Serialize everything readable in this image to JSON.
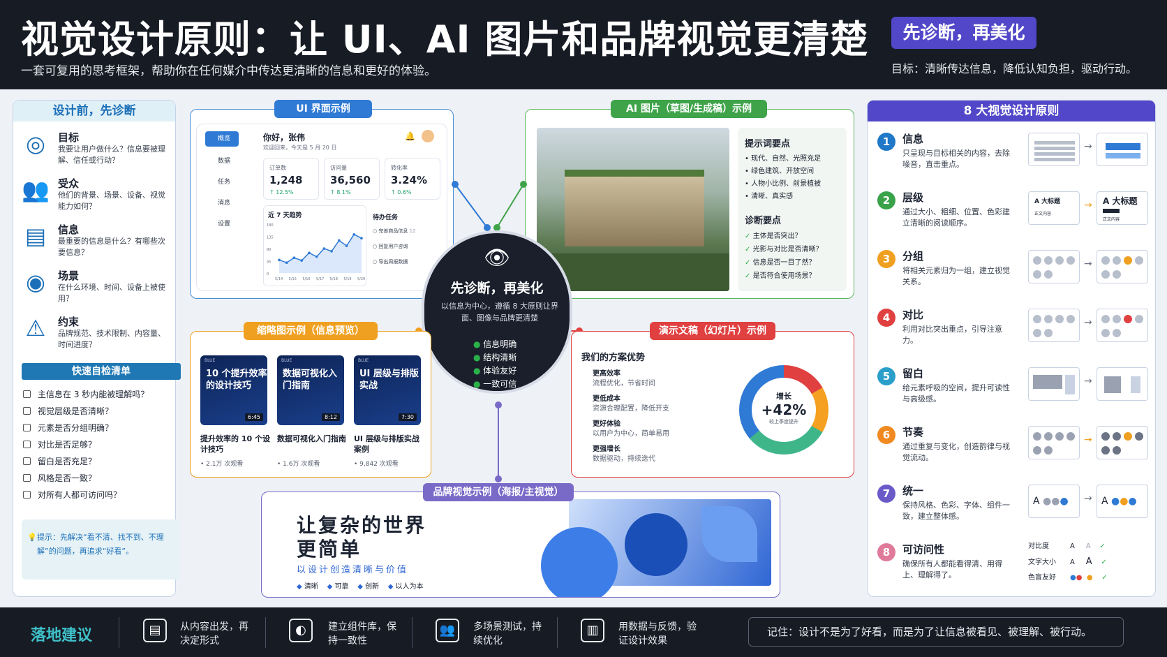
{
  "header": {
    "title": "视觉设计原则：让 UI、AI 图片和品牌视觉更清楚",
    "subtitle": "一套可复用的思考框架，帮助你在任何媒介中传达更清晰的信息和更好的体验。",
    "badge": "先诊断，再美化",
    "goal": "目标：清晰传达信息，降低认知负担，驱动行动。"
  },
  "left": {
    "title": "设计前，先诊断",
    "items": [
      {
        "icon": "target-icon",
        "title": "目标",
        "desc": "我要让用户做什么？信息要被理解、信任或行动？"
      },
      {
        "icon": "people-icon",
        "title": "受众",
        "desc": "他们的背景、场景、设备、视觉能力如何？"
      },
      {
        "icon": "document-icon",
        "title": "信息",
        "desc": "最重要的信息是什么？有哪些次要信息？"
      },
      {
        "icon": "eye-icon",
        "title": "场景",
        "desc": "在什么环境、时间、设备上被使用？"
      },
      {
        "icon": "warning-icon",
        "title": "约束",
        "desc": "品牌规范、技术限制、内容量、时间进度？"
      }
    ],
    "checklist_title": "快速自检清单",
    "checklist": [
      "主信息在 3 秒内能被理解吗？",
      "视觉层级是否清晰？",
      "元素是否分组明确？",
      "对比是否足够？",
      "留白是否充足？",
      "风格是否一致？",
      "对所有人都可访问吗？"
    ],
    "tip": "提示：先解决“看不清、找不到、不理解”的问题，再追求“好看”。"
  },
  "ui": {
    "title": "UI 界面示例",
    "nav": [
      "概览",
      "数据",
      "任务",
      "消息",
      "设置"
    ],
    "greeting": "你好，张伟",
    "welcome": "欢迎回来，今天是 5 月 20 日",
    "stats": [
      {
        "label": "订单数",
        "value": "1,248",
        "change": "↑ 12.5%"
      },
      {
        "label": "访问量",
        "value": "36,560",
        "change": "↑ 8.1%"
      },
      {
        "label": "转化率",
        "value": "3.24%",
        "change": "↑ 0.6%"
      }
    ],
    "trend_title": "近 7 天趋势",
    "trend_y": [
      "180",
      "135",
      "90",
      "45",
      "0"
    ],
    "trend_x": [
      "5/14",
      "5/15",
      "5/16",
      "5/17",
      "5/18",
      "5/19",
      "5/20"
    ],
    "trend_values": [
      48,
      38,
      56,
      46,
      74,
      60,
      90,
      80,
      120,
      100,
      142,
      128
    ],
    "todo_title": "待办任务",
    "todos": [
      "完善商品信息",
      "回复用户咨询",
      "导出周报数据"
    ],
    "todo_count": "12"
  },
  "ai": {
    "title": "AI 图片（草图/生成稿）示例",
    "prompt_title": "提示词要点",
    "prompts": [
      "现代、自然、光照充足",
      "绿色建筑、开放空间",
      "人物小比例、前景植被",
      "清晰、真实感"
    ],
    "diag_title": "诊断要点",
    "diags": [
      "主体是否突出？",
      "光影与对比是否清晰？",
      "信息是否一目了然？",
      "是否符合使用场景？"
    ]
  },
  "center": {
    "title": "先诊断，再美化",
    "desc": "以信息为中心，遵循 8 大原则让界面、图像与品牌更清楚",
    "checks": [
      "信息明确",
      "结构清晰",
      "体验友好",
      "一致可信"
    ]
  },
  "thumbs": {
    "title": "缩略图示例（信息预览）",
    "items": [
      {
        "text": "10 个提升效率的设计技巧",
        "tag": "6:45",
        "caption": "提升效率的 10 个设计技巧",
        "views": "• 2.1万 次观看",
        "badge": "BLUE"
      },
      {
        "text": "数据可视化入门指南",
        "tag": "8:12",
        "caption": "数据可视化入门指南",
        "views": "• 1.6万 次观看",
        "badge": "BLUE"
      },
      {
        "text": "UI 层级与排版实战",
        "tag": "7:30",
        "caption": "UI 层级与排版实战案例",
        "views": "• 9,842 次观看",
        "badge": "BLUE"
      }
    ]
  },
  "slides": {
    "title": "演示文稿（幻灯片）示例",
    "heading": "我们的方案优势",
    "items": [
      {
        "title": "更高效率",
        "desc": "流程优化，节省时间"
      },
      {
        "title": "更低成本",
        "desc": "资源合理配置，降低开支"
      },
      {
        "title": "更好体验",
        "desc": "以用户为中心，简单易用"
      },
      {
        "title": "更强增长",
        "desc": "数据驱动，持续迭代"
      }
    ],
    "donut_label": "增长",
    "donut_value": "+42%",
    "donut_sub": "较上季度提升"
  },
  "brand": {
    "title": "品牌视觉示例（海报/主视觉）",
    "headline1": "让复杂的世界",
    "headline2": "更简单",
    "slogan": "以设计创造清晰与价值",
    "tags": [
      "清晰",
      "可靠",
      "创新",
      "以人为本"
    ]
  },
  "principles": {
    "title": "8 大视觉设计原则",
    "items": [
      {
        "num": "1",
        "title": "信息",
        "desc": "只呈现与目标相关的内容，去除噪音，直击重点。",
        "color": "#1f78c8"
      },
      {
        "num": "2",
        "title": "层级",
        "desc": "通过大小、粗细、位置、色彩建立清晰的阅读顺序。",
        "color": "#3aa34a",
        "a": "A 大标题",
        "b": "正文内容"
      },
      {
        "num": "3",
        "title": "分组",
        "desc": "将相关元素归为一组，建立视觉关系。",
        "color": "#f0a020"
      },
      {
        "num": "4",
        "title": "对比",
        "desc": "利用对比突出重点，引导注意力。",
        "color": "#e04040"
      },
      {
        "num": "5",
        "title": "留白",
        "desc": "给元素呼吸的空间，提升可读性与高级感。",
        "color": "#2a9fc9"
      },
      {
        "num": "6",
        "title": "节奏",
        "desc": "通过重复与变化，创造韵律与视觉流动。",
        "color": "#f08a20"
      },
      {
        "num": "7",
        "title": "统一",
        "desc": "保持风格、色彩、字体、组件一致，建立整体感。",
        "color": "#6a5ac8"
      },
      {
        "num": "8",
        "title": "可访问性",
        "desc": "确保所有人都能看得清、用得上、理解得了。",
        "color": "#e07a9a"
      }
    ],
    "access": [
      "对比度",
      "文字大小",
      "色盲友好"
    ]
  },
  "footer": {
    "title": "落地建议",
    "items": [
      "从内容出发，再决定形式",
      "建立组件库，保持一致性",
      "多场景测试，持续优化",
      "用数据与反馈，验证设计效果"
    ],
    "memo": "记住：设计不是为了好看，而是为了让信息被看见、被理解、被行动。"
  }
}
